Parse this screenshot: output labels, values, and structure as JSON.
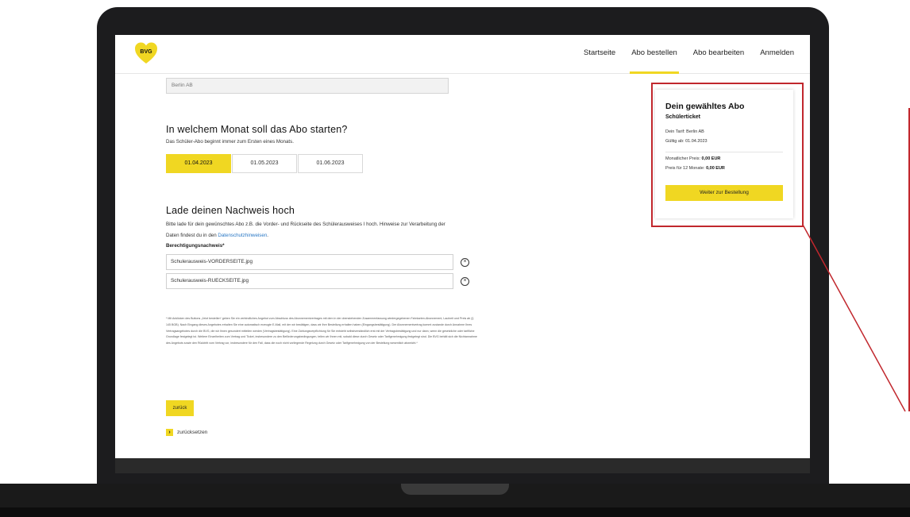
{
  "logo": {
    "text": "BVG"
  },
  "nav": {
    "items": [
      {
        "label": "Startseite"
      },
      {
        "label": "Abo bestellen"
      },
      {
        "label": "Abo bearbeiten"
      },
      {
        "label": "Anmelden"
      }
    ]
  },
  "form": {
    "tarif_value": "Berlin AB",
    "month_heading": "In welchem Monat soll das Abo starten?",
    "month_hint": "Das Schüler-Abo beginnt immer zum Ersten eines Monats.",
    "months": [
      {
        "label": "01.04.2023",
        "selected": true
      },
      {
        "label": "01.05.2023",
        "selected": false
      },
      {
        "label": "01.06.2023",
        "selected": false
      }
    ],
    "upload_heading": "Lade deinen Nachweis hoch",
    "upload_text": "Bitte lade für dein gewünschtes Abo z.B. die Vorder- und Rückseite des Schülerausweises I hoch. Hinweise zur Verarbeitung der Daten findest du in den",
    "upload_link": "Datenschutzhinweisen",
    "upload_text_end": ".",
    "proof_label": "Berechtigungsnachweis*",
    "files": [
      {
        "name": "Schulerausweis-VORDERSEITE.jpg"
      },
      {
        "name": "Schulerausweis-RUECKSEITE.jpg"
      }
    ],
    "fine_print": "* Mit Anklicken des Buttons „Jetzt bestellen“ geben Sie ein verbindliches Angebot zum Abschluss des Abonnementvertrages mit dem in der obenstehenden Zusammenfassung wiedergegebenen Fahrkarten-Abonnement, Laufzeit und Preis ab (§ 145 BGB). Nach Eingang dieses Angebotes erhalten Sie eine automatisch erzeugte E-Mail, mit der wir bestätigen, dass wir Ihre Bestellung erhalten haben (Eingangsbestätigung). Der Abonnementvertrag kommt zustande durch Annahme Ihres Vertragsangebotes durch die BVG, die wir Ihnen gesondert mitteilen werden (Vertragsbestätigung). Eine Zahlungsverpflichtung für Sie entsteht selbstverständlich erst mit der Vertragsbestätigung und nur dann, wenn die gesetzliche oder tarifliche Grundlage festgelegt ist. Weitere Einzelheiten zum Vertrag und Ticket, insbesondere zu den Beförderungsbedingungen, teilen wir Ihnen mit, sobald diese durch Gesetz oder Tarifgenehmigung festgelegt sind. Die BVG behält sich die Nichtannahme des Angebots sowie den Rücktritt vom Vertrag vor, insbesondere für den Fall, dass die noch nicht vorliegende Regelung durch Gesetz oder Tarifgenehmigung von der Bestellung wesentlich abweicht.*",
    "back_label": "zurück",
    "reset_label": "zurücksetzen"
  },
  "summary": {
    "title": "Dein gewähltes Abo",
    "ticket": "Schülerticket",
    "tarif": "Dein Tarif: Berlin AB",
    "valid_from": "Gültig ab: 01.04.2023",
    "monthly_label": "Monatlicher Preis: ",
    "monthly_value": "0,00 EUR",
    "yearly_label": "Preis für 12 Monate: ",
    "yearly_value": "0,00 EUR",
    "cta_label": "Weiter zur Bestellung"
  },
  "colors": {
    "brand_yellow": "#f0d722",
    "highlight_red": "#c1272d",
    "link_blue": "#2a78c5"
  }
}
